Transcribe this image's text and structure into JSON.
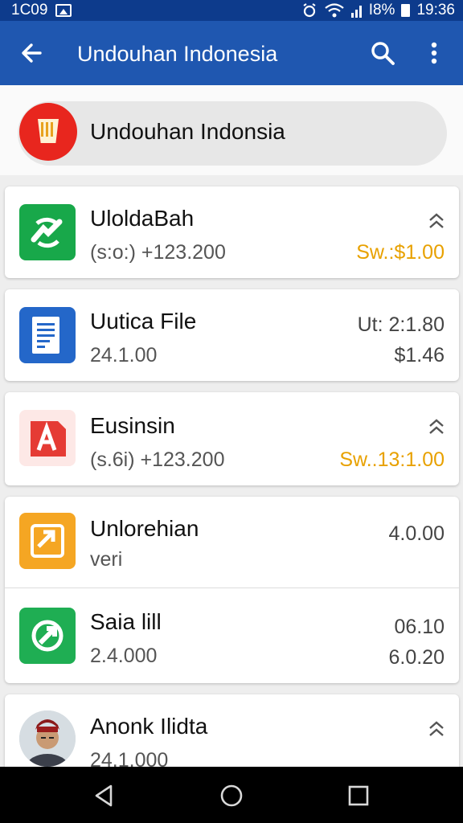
{
  "status_bar": {
    "left_text": "1C09",
    "battery_percent_text": "I8%",
    "time": "19:36",
    "icons": [
      "image-icon",
      "alarm-icon",
      "wifi-icon",
      "signal-icon",
      "battery-icon"
    ]
  },
  "app_bar": {
    "title": "Undouhan Indonesia",
    "icons": [
      "back-arrow-icon",
      "search-icon",
      "more-vert-icon"
    ]
  },
  "header": {
    "title": "Undouhan Indonsia",
    "logo_icon": "store-basket-icon"
  },
  "items": [
    {
      "name": "UloldaBah",
      "sub": "(s:o:) +123.200",
      "right_top": "",
      "right_bottom": "Sw.:$1.00",
      "chevron": true,
      "icon": "green-arrow-icon"
    },
    {
      "name": "Uutica File",
      "sub": "24.1.00",
      "right_top": "Ut: 2:1.80",
      "right_bottom": "$1.46",
      "chevron": false,
      "icon": "document-icon"
    },
    {
      "name": "Eusinsin",
      "sub": "(s.6i) +123.200",
      "right_top": "",
      "right_bottom": "Sw..13:1.00",
      "chevron": true,
      "icon": "pdf-a-icon"
    },
    {
      "name": "Unlorehian",
      "sub": "veri",
      "right_top": "4.0.00",
      "right_bottom": "",
      "chevron": false,
      "icon": "orange-sync-icon"
    },
    {
      "name": "Saia lill",
      "sub": "2.4.000",
      "right_top": "06.10",
      "right_bottom": "6.0.20",
      "chevron": false,
      "icon": "green-link-icon"
    },
    {
      "name": "Anonk Ilidta",
      "sub": "24.1.000",
      "right_top": "",
      "right_bottom": "",
      "chevron": true,
      "icon": "avatar-photo"
    }
  ],
  "nav_bar": {
    "icons": [
      "nav-back-icon",
      "nav-home-icon",
      "nav-recents-icon"
    ]
  },
  "colors": {
    "status_bar": "#0d3b8c",
    "app_bar": "#1f57b0",
    "accent_orange": "#e8a100",
    "logo_red": "#e8261e"
  }
}
